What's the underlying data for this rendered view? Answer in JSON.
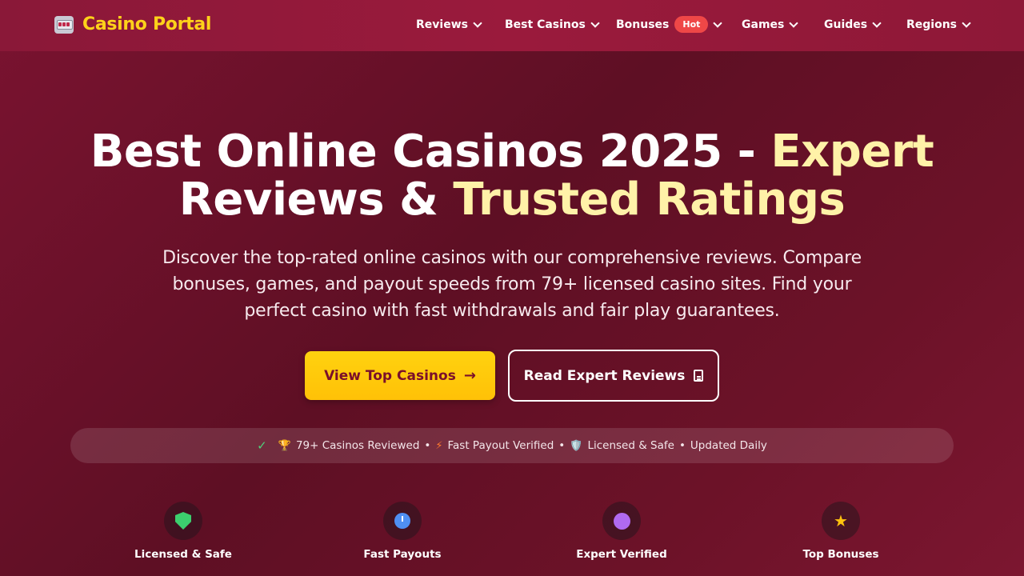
{
  "nav": {
    "brand": "Casino Portal",
    "items": [
      {
        "label": "Reviews"
      },
      {
        "label": "Best Casinos"
      },
      {
        "label": "Bonuses",
        "badge": "Hot"
      },
      {
        "label": "Games"
      },
      {
        "label": "Guides"
      },
      {
        "label": "Regions"
      }
    ]
  },
  "hero": {
    "title_part1": "Best Online Casinos 2025 - ",
    "title_part2": "Expert",
    "title_line2_white": "Reviews & ",
    "title_line2_yellow": "Trusted Ratings",
    "subtitle": "Discover the top-rated online casinos with our comprehensive reviews. Compare bonuses, games, and payout speeds from 79+ licensed casino sites. Find your perfect casino with fast withdrawals and fair play guarantees.",
    "primary_button": "View Top Casinos",
    "secondary_button": "Read Expert Reviews"
  },
  "trust": {
    "item1": "79+ Casinos Reviewed",
    "item2": "Fast Payout Verified",
    "item3": "Licensed & Safe",
    "item4": "Updated Daily",
    "sep": "•"
  },
  "features": [
    {
      "label": "Licensed & Safe"
    },
    {
      "label": "Fast Payouts"
    },
    {
      "label": "Expert Verified"
    },
    {
      "label": "Top Bonuses"
    }
  ],
  "colors": {
    "brand": "#ffd21a",
    "accent_button": "#ffc107",
    "hot_badge": "#ef4747",
    "background": "#6c1228"
  }
}
